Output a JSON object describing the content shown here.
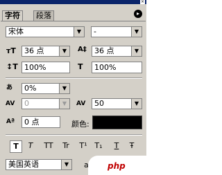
{
  "tabs": [
    {
      "label": "字符"
    },
    {
      "label": "段落"
    }
  ],
  "font": {
    "family": "宋体",
    "style": "-"
  },
  "size": {
    "font_size": "36 点",
    "leading": "36 点"
  },
  "scale": {
    "vertical": "100%",
    "horizontal": "100%"
  },
  "spacing": {
    "tsume": "0%",
    "kerning": "0",
    "tracking": "50"
  },
  "baseline": {
    "shift": "0 点"
  },
  "color_label": "颜色:",
  "color": "#000000",
  "style_buttons": [
    "T",
    "T",
    "TT",
    "Tr",
    "T¹",
    "T₁",
    "T",
    "Ŧ"
  ],
  "language": "美国英语",
  "aa_label": "a",
  "watermark": "php"
}
